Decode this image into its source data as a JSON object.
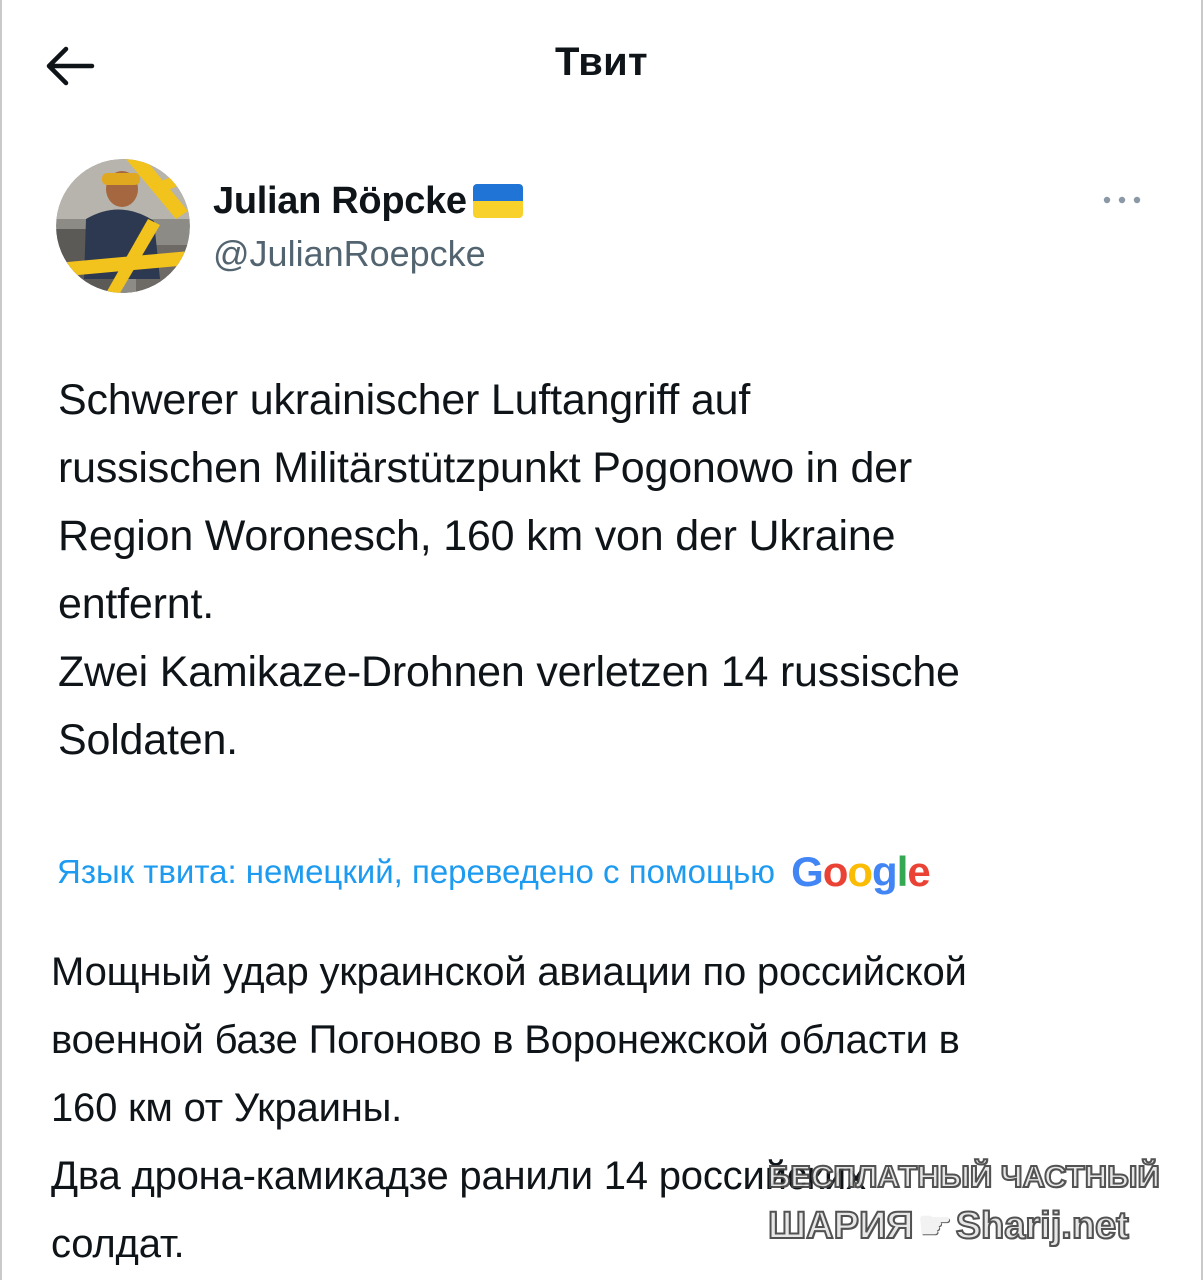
{
  "header": {
    "title": "Твит",
    "back_icon": "arrow-left-icon"
  },
  "author": {
    "display_name": "Julian Röpcke",
    "flag": "ukraine-flag-emoji",
    "handle": "@JulianRoepcke",
    "more_icon": "more-horizontal-icon"
  },
  "tweet": {
    "text": "Schwerer ukrainischer Luftangriff auf\nrussischen Militärstützpunkt Pogonowo in der\nRegion Woronesch, 160 km von der Ukraine\nentfernt.\nZwei Kamikaze-Drohnen verletzen 14 russische\nSoldaten.",
    "translation_label": "Язык твита: немецкий, переведено с помощью",
    "translation_provider": "Google",
    "translated_text": "Мощный удар украинской авиации по российской\nвоенной базе Погоново в Воронежской области в\n160 км от Украины.\nДва дрона-камикадзе ранили 14 российских\nсолдат."
  },
  "watermark": {
    "line1": "БЕСПЛАТНЫЙ ЧАСТНЫЙ",
    "line2_left": "ШАРИЯ",
    "line2_right": "Sharij.net"
  },
  "colors": {
    "text": "#0f1419",
    "secondary": "#536471",
    "link": "#1d9bf0"
  }
}
